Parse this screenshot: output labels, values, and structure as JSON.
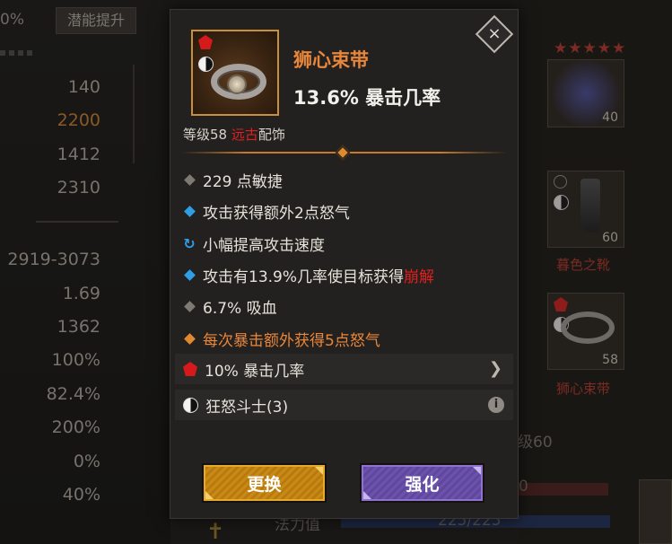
{
  "background": {
    "top_percent": "0%",
    "potential_button_label": "潜能提升",
    "stats": [
      "140",
      "2200",
      "1412",
      "2310",
      "2919-3073",
      "1.69",
      "1362",
      "100%",
      "82.4%",
      "200%",
      "0%",
      "40%"
    ],
    "right_panel": {
      "slot_level_top": "40",
      "slot_level_boots": "60",
      "slot_name_boots": "暮色之靴",
      "slot_level_belt": "58",
      "slot_name_belt": "狮心束带",
      "level_fragment": "级60",
      "hp_fragment": "0",
      "mana_label": "法力值",
      "mana_value": "225/225"
    }
  },
  "tooltip": {
    "item_name": "狮心束带",
    "main_stat": "13.6% 暴击几率",
    "level_prefix": "等级58 ",
    "rarity": "远古",
    "slot_type": "配饰",
    "stats": {
      "s1": "229 点敏捷",
      "s2": "攻击获得额外2点怒气",
      "s3": "小幅提高攻击速度",
      "s4_prefix": "攻击有13.9%几率使目标获得",
      "s4_effect": "崩解",
      "s5": "6.7% 吸血",
      "s6": "每次暴击额外获得5点怒气"
    },
    "gem_socket": "10% 暴击几率",
    "set_bonus": "狂怒斗士(3)",
    "buttons": {
      "swap": "更换",
      "upgrade": "强化"
    },
    "close_symbol": "×",
    "info_symbol": "i",
    "chevron_symbol": "❯"
  },
  "colors": {
    "legendary_orange": "#e8863a",
    "ancient_red": "#e01f1f",
    "magic_blue": "#2f9ee8",
    "swap_gold": "#c98a14",
    "upgrade_purple": "#6d52ad"
  }
}
